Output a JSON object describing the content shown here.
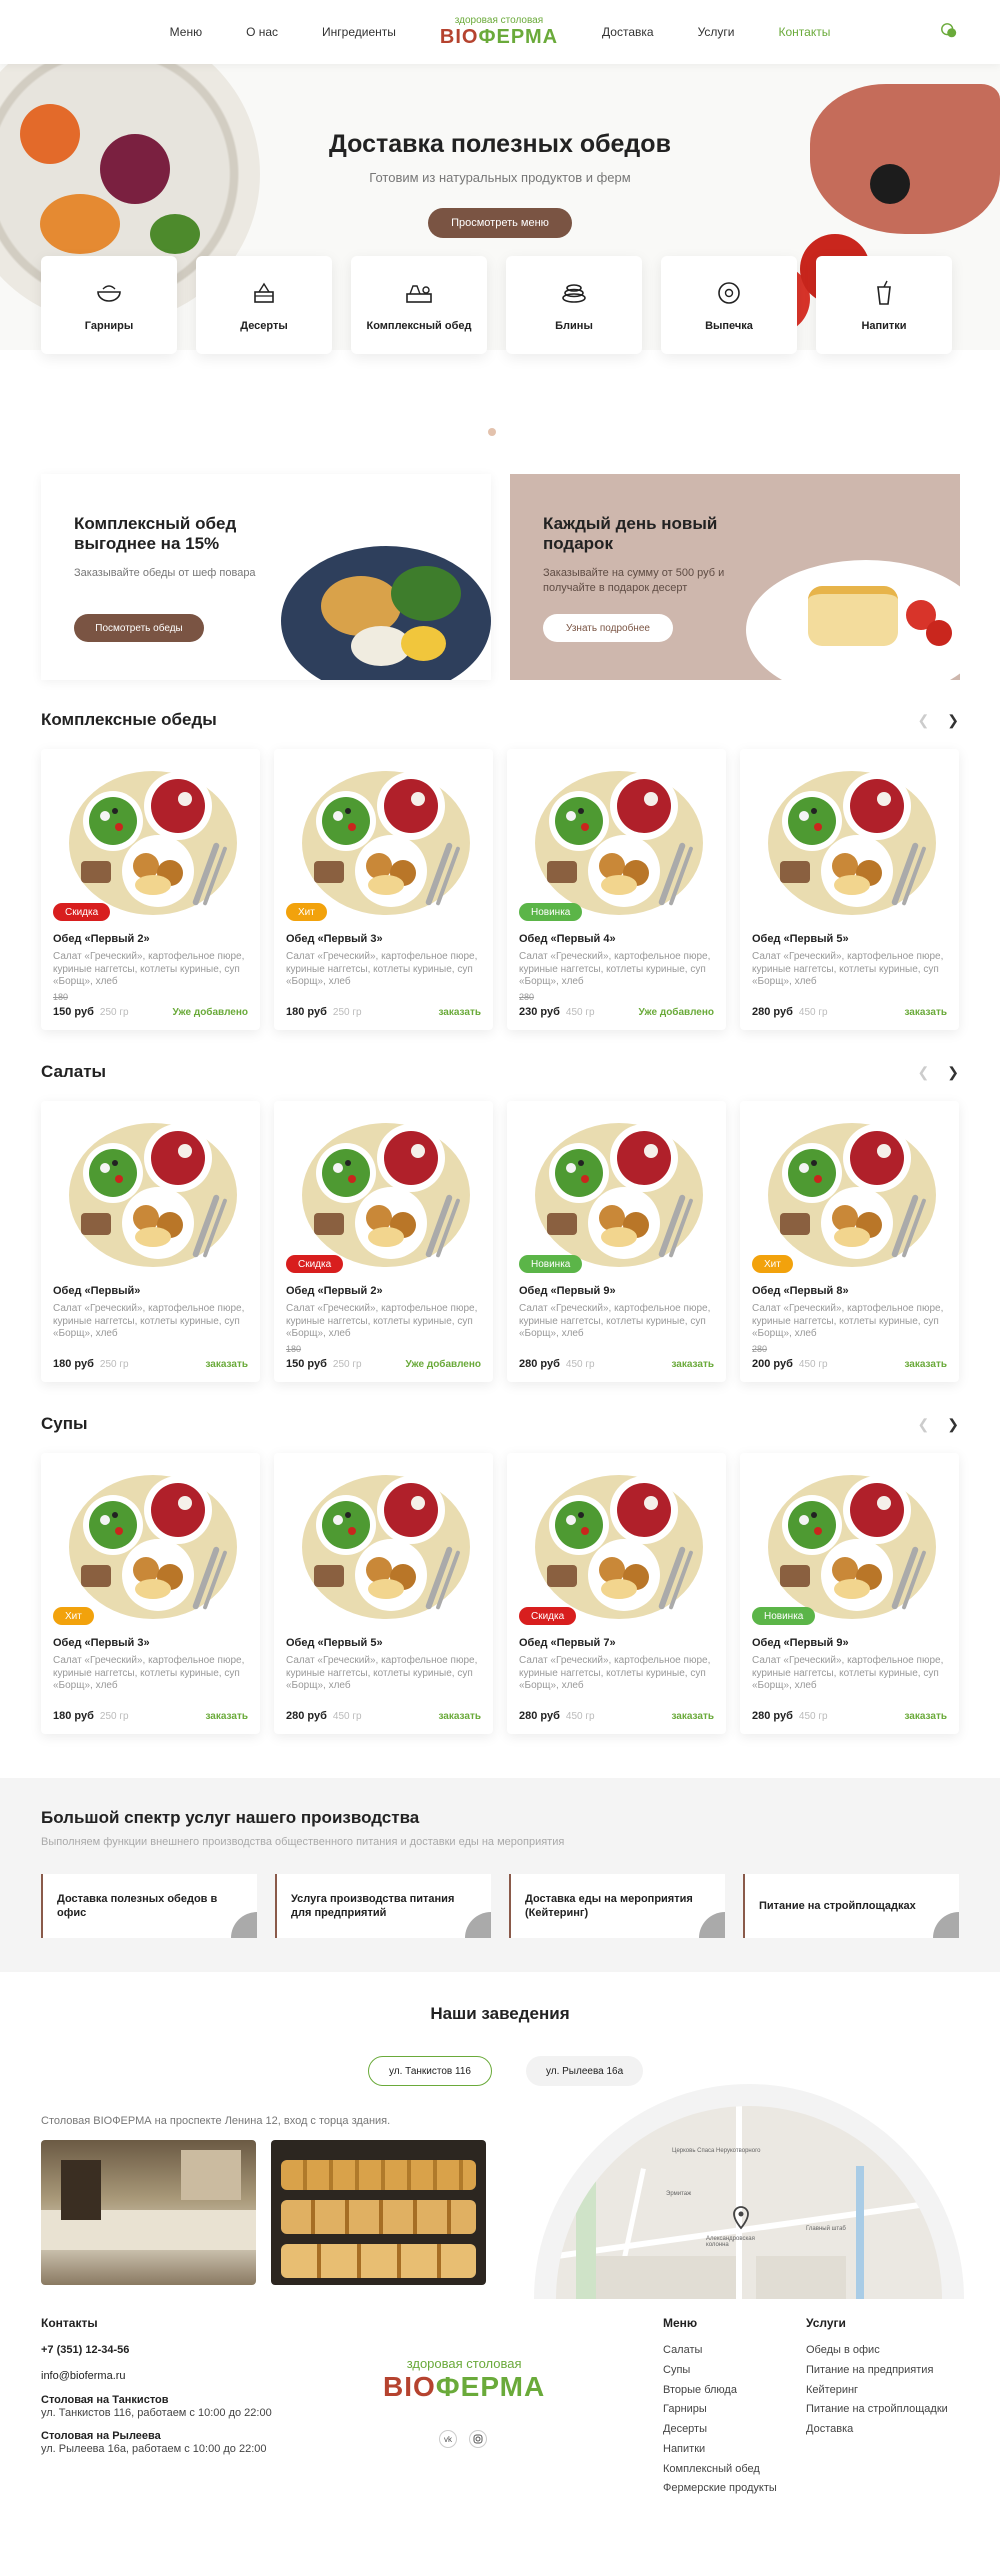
{
  "header": {
    "nav_left": [
      "Меню",
      "О нас",
      "Ингредиенты"
    ],
    "nav_right": [
      "Доставка",
      "Услуги",
      "Контакты"
    ],
    "logo_tagline": "здоровая столовая",
    "logo_word_a": "BIO",
    "logo_word_b": "ФЕРМА",
    "chat_icon": "chat-icon"
  },
  "hero": {
    "title": "Доставка полезных обедов",
    "subtitle": "Готовим из натуральных продуктов и ферм",
    "button": "Просмотреть меню"
  },
  "categories": [
    "Гарниры",
    "Десерты",
    "Комплексный обед",
    "Блины",
    "Выпечка",
    "Напитки"
  ],
  "promos": [
    {
      "title": "Комплексный обед выгоднее на 15%",
      "text": "Заказывайте обеды от шеф повара",
      "button": "Посмотреть обеды"
    },
    {
      "title": "Каждый день новый подарок",
      "text": "Заказывайте на сумму от 500 руб и получайте в подарок десерт",
      "button": "Узнать подробнее"
    }
  ],
  "colors": {
    "accent_green": "#6aaa3a",
    "brand_brown": "#7a5443",
    "sale_red": "#d81e1e",
    "hit_orange": "#f2a20c",
    "new_green": "#5bb548"
  },
  "sections": [
    {
      "title": "Комплексные обеды",
      "cards": [
        {
          "badge": "Скидка",
          "badge_type": "sale",
          "name": "Обед «Первый 2»",
          "desc": "Салат «Греческий», картофельное пюре, куриные наггетсы, котлеты куриные, суп «Борщ», хлеб",
          "old_price": "180",
          "price": "150 руб",
          "weight": "250 гр",
          "cta": "Уже добавлено"
        },
        {
          "badge": "Хит",
          "badge_type": "hit",
          "name": "Обед «Первый 3»",
          "desc": "Салат «Греческий», картофельное пюре, куриные наггетсы, котлеты куриные, суп «Борщ», хлеб",
          "old_price": "",
          "price": "180 руб",
          "weight": "250 гр",
          "cta": "заказать"
        },
        {
          "badge": "Новинка",
          "badge_type": "new",
          "name": "Обед «Первый 4»",
          "desc": "Салат «Греческий», картофельное пюре, куриные наггетсы, котлеты куриные, суп «Борщ», хлеб",
          "old_price": "280",
          "price": "230 руб",
          "weight": "450 гр",
          "cta": "Уже добавлено"
        },
        {
          "badge": "",
          "badge_type": "",
          "name": "Обед «Первый 5»",
          "desc": "Салат «Греческий», картофельное пюре, куриные наггетсы, котлеты куриные, суп «Борщ», хлеб",
          "old_price": "",
          "price": "280 руб",
          "weight": "450 гр",
          "cta": "заказать"
        }
      ]
    },
    {
      "title": "Салаты",
      "cards": [
        {
          "badge": "",
          "badge_type": "",
          "name": "Обед «Первый»",
          "desc": "Салат «Греческий», картофельное пюре, куриные наггетсы, котлеты куриные, суп «Борщ», хлеб",
          "old_price": "",
          "price": "180 руб",
          "weight": "250 гр",
          "cta": "заказать"
        },
        {
          "badge": "Скидка",
          "badge_type": "sale",
          "name": "Обед «Первый 2»",
          "desc": "Салат «Греческий», картофельное пюре, куриные наггетсы, котлеты куриные, суп «Борщ», хлеб",
          "old_price": "180",
          "price": "150 руб",
          "weight": "250 гр",
          "cta": "Уже добавлено"
        },
        {
          "badge": "Новинка",
          "badge_type": "new",
          "name": "Обед «Первый 9»",
          "desc": "Салат «Греческий», картофельное пюре, куриные наггетсы, котлеты куриные, суп «Борщ», хлеб",
          "old_price": "",
          "price": "280 руб",
          "weight": "450 гр",
          "cta": "заказать"
        },
        {
          "badge": "Хит",
          "badge_type": "hit",
          "name": "Обед «Первый 8»",
          "desc": "Салат «Греческий», картофельное пюре, куриные наггетсы, котлеты куриные, суп «Борщ», хлеб",
          "old_price": "280",
          "price": "200 руб",
          "weight": "450 гр",
          "cta": "заказать"
        }
      ]
    },
    {
      "title": "Супы",
      "cards": [
        {
          "badge": "Хит",
          "badge_type": "hit",
          "name": "Обед «Первый 3»",
          "desc": "Салат «Греческий», картофельное пюре, куриные наггетсы, котлеты куриные, суп «Борщ», хлеб",
          "old_price": "",
          "price": "180 руб",
          "weight": "250 гр",
          "cta": "заказать"
        },
        {
          "badge": "",
          "badge_type": "",
          "name": "Обед «Первый 5»",
          "desc": "Салат «Греческий», картофельное пюре, куриные наггетсы, котлеты куриные, суп «Борщ», хлеб",
          "old_price": "",
          "price": "280 руб",
          "weight": "450 гр",
          "cta": "заказать"
        },
        {
          "badge": "Скидка",
          "badge_type": "sale",
          "name": "Обед «Первый 7»",
          "desc": "Салат «Греческий», картофельное пюре, куриные наггетсы, котлеты куриные, суп «Борщ», хлеб",
          "old_price": "",
          "price": "280 руб",
          "weight": "450 гр",
          "cta": "заказать"
        },
        {
          "badge": "Новинка",
          "badge_type": "new",
          "name": "Обед «Первый 9»",
          "desc": "Салат «Греческий», картофельное пюре, куриные наггетсы, котлеты куриные, суп «Борщ», хлеб",
          "old_price": "",
          "price": "280 руб",
          "weight": "450 гр",
          "cta": "заказать"
        }
      ]
    }
  ],
  "services": {
    "title": "Большой спектр услуг нашего производства",
    "subtitle": "Выполняем функции внешнего производства общественного питания и доставки еды на мероприятия",
    "items": [
      "Доставка полезных обедов в офис",
      "Услуга производства питания для предприятий",
      "Доставка еды на мероприятия (Кейтеринг)",
      "Питание на стройплощадках"
    ]
  },
  "places": {
    "title": "Наши заведения",
    "tabs": [
      "ул. Танкистов 116",
      "ул. Рылеева 16а"
    ],
    "text": "Столовая BIOФЕРМА на проспекте Ленина 12, вход с торца здания.",
    "map_labels": [
      "Церковь Спаса Нерукотворного",
      "Александровская колонна",
      "Главный штаб",
      "Эрмитаж"
    ]
  },
  "footer": {
    "contacts_title": "Контакты",
    "phone": "+7 (351) 12-34-56",
    "email": "info@bioferma.ru",
    "addr1_title": "Столовая на Танкистов",
    "addr1": "ул. Танкистов 116, работаем с 10:00 до 22:00",
    "addr2_title": "Столовая на Рылеева",
    "addr2": "ул. Рылеева 16а, работаем с 10:00 до 22:00",
    "logo_tagline": "здоровая столовая",
    "logo_word_a": "BIO",
    "logo_word_b": "ФЕРМА",
    "menu_title": "Меню",
    "menu_items": [
      "Салаты",
      "Супы",
      "Вторые блюда",
      "Гарниры",
      "Десерты",
      "Напитки",
      "Комплексный обед",
      "Фермерские продукты"
    ],
    "services_title": "Услуги",
    "services_items": [
      "Обеды в офис",
      "Питание на предприятия",
      "Кейтеринг",
      "Питание на стройплощадки",
      "Доставка"
    ],
    "socials": [
      "vk-icon",
      "instagram-icon"
    ]
  }
}
